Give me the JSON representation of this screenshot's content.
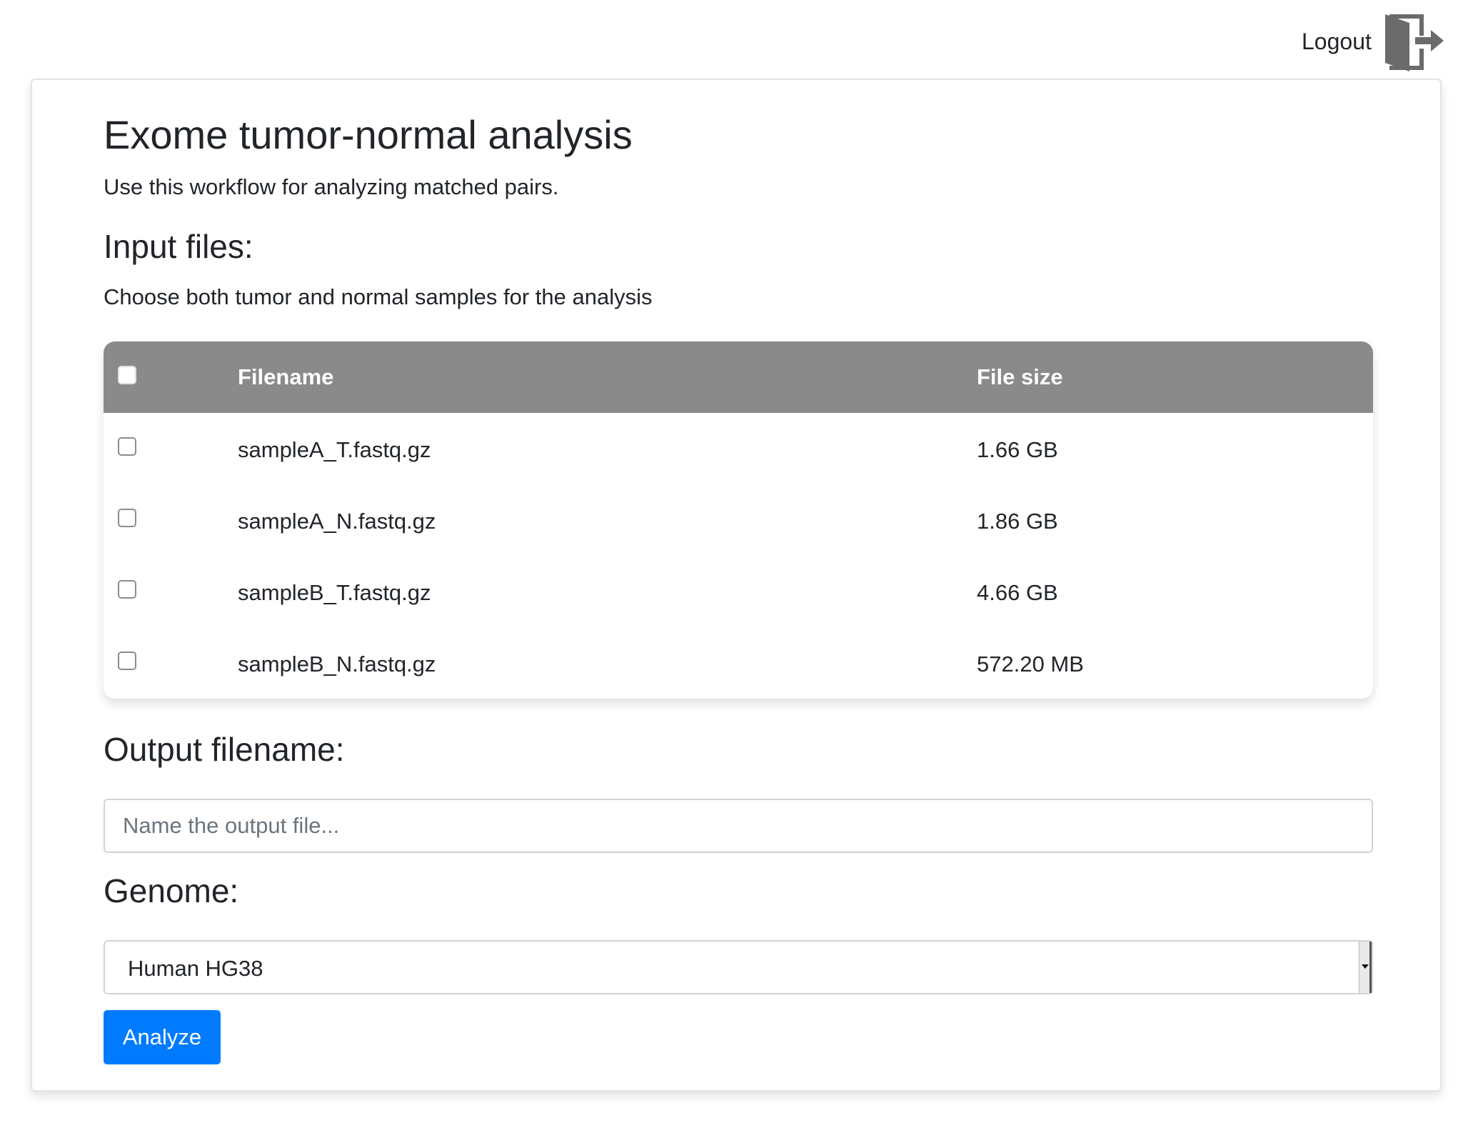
{
  "topbar": {
    "logout_label": "Logout",
    "logout_icon": "exit-door-icon"
  },
  "page": {
    "title": "Exome tumor-normal analysis",
    "subtitle": "Use this workflow for analyzing matched pairs."
  },
  "input_files": {
    "heading": "Input files:",
    "description": "Choose both tumor and normal samples for the analysis",
    "columns": {
      "filename": "Filename",
      "filesize": "File size"
    },
    "header_color": "#8a8a8a",
    "rows": [
      {
        "filename": "sampleA_T.fastq.gz",
        "size": "1.66 GB",
        "checked": false
      },
      {
        "filename": "sampleA_N.fastq.gz",
        "size": "1.86 GB",
        "checked": false
      },
      {
        "filename": "sampleB_T.fastq.gz",
        "size": "4.66 GB",
        "checked": false
      },
      {
        "filename": "sampleB_N.fastq.gz",
        "size": "572.20 MB",
        "checked": false
      }
    ]
  },
  "output": {
    "heading": "Output filename:",
    "value": "",
    "placeholder": "Name the output file..."
  },
  "genome": {
    "heading": "Genome:",
    "selected": "Human HG38"
  },
  "actions": {
    "analyze_label": "Analyze",
    "accent_color": "#007bff"
  }
}
